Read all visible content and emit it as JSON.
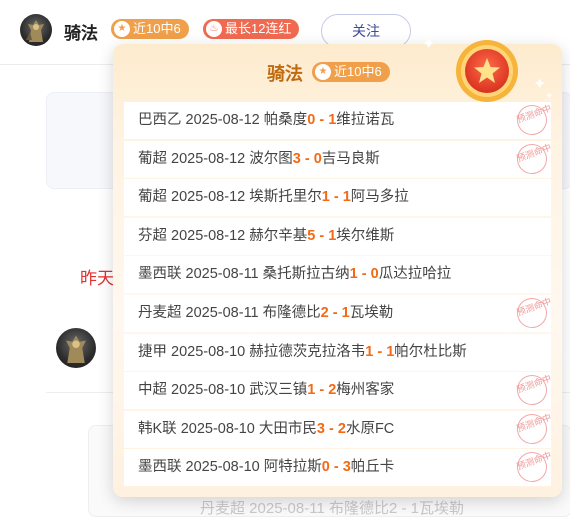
{
  "header": {
    "name": "骑法",
    "badge_recent": "近10中6",
    "badge_streak": "最长12连红",
    "follow_label": "关注",
    "accent": "#f0a04a",
    "streak_color": "#f06a52"
  },
  "background": {
    "date_label": "昨天",
    "peek_text": "丹麦超 2025-08-11 布隆德比2 - 1瓦埃勒"
  },
  "popup": {
    "title": "骑法",
    "badge": "近10中6",
    "stamp_text": "预测命中",
    "rows": [
      {
        "league": "巴西乙",
        "date": "2025-08-12",
        "home": "帕桑度",
        "home_score": "0",
        "sep": " - ",
        "away_score": "1",
        "away": "维拉诺瓦",
        "hit": true
      },
      {
        "league": "葡超",
        "date": "2025-08-12",
        "home": "波尔图",
        "home_score": "3",
        "sep": " - ",
        "away_score": "0",
        "away": "吉马良斯",
        "hit": true
      },
      {
        "league": "葡超",
        "date": "2025-08-12",
        "home": "埃斯托里尔",
        "home_score": "1",
        "sep": " - ",
        "away_score": "1",
        "away": "阿马多拉",
        "hit": false
      },
      {
        "league": "芬超",
        "date": "2025-08-12",
        "home": "赫尔辛基",
        "home_score": "5",
        "sep": " - ",
        "away_score": "1",
        "away": "埃尔维斯",
        "hit": false
      },
      {
        "league": "墨西联",
        "date": "2025-08-11",
        "home": "桑托斯拉古纳",
        "home_score": "1",
        "sep": " - ",
        "away_score": "0",
        "away": "瓜达拉哈拉",
        "hit": false
      },
      {
        "league": "丹麦超",
        "date": "2025-08-11",
        "home": "布隆德比",
        "home_score": "2",
        "sep": " - ",
        "away_score": "1",
        "away": "瓦埃勒",
        "hit": true
      },
      {
        "league": "捷甲",
        "date": "2025-08-10",
        "home": "赫拉德茨克拉洛韦",
        "home_score": "1",
        "sep": " - ",
        "away_score": "1",
        "away": "帕尔杜比斯",
        "hit": false
      },
      {
        "league": "中超",
        "date": "2025-08-10",
        "home": "武汉三镇",
        "home_score": "1",
        "sep": " - ",
        "away_score": "2",
        "away": "梅州客家",
        "hit": true
      },
      {
        "league": "韩K联",
        "date": "2025-08-10",
        "home": "大田市民",
        "home_score": "3",
        "sep": " - ",
        "away_score": "2",
        "away": "水原FC",
        "hit": true
      },
      {
        "league": "墨西联",
        "date": "2025-08-10",
        "home": "阿特拉斯",
        "home_score": "0",
        "sep": " - ",
        "away_score": "3",
        "away": "帕丘卡",
        "hit": true
      }
    ]
  }
}
